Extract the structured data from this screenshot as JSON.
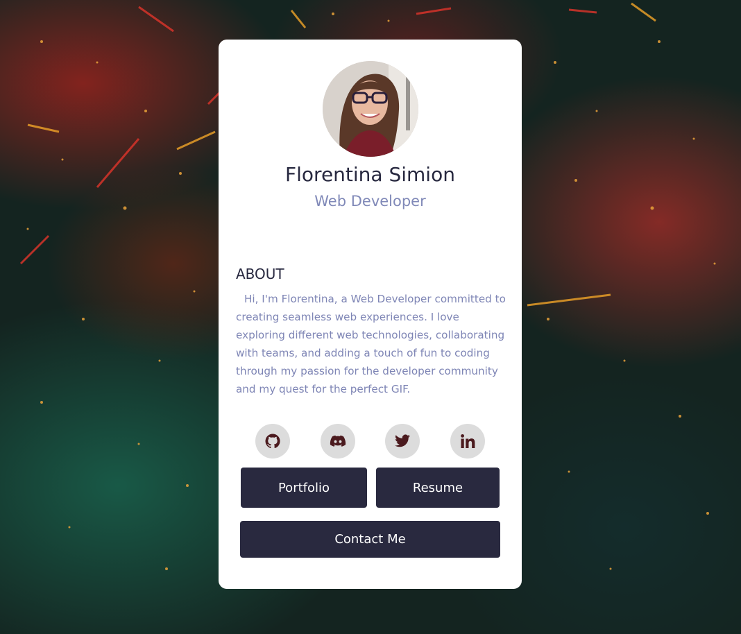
{
  "profile": {
    "name": "Florentina Simion",
    "role": "Web Developer"
  },
  "about": {
    "heading": "ABOUT",
    "text": "Hi, I'm Florentina, a Web Developer committed to creating seamless web experiences. I love exploring different web technologies, collaborating with teams, and adding a touch of fun to coding through my passion for the developer community and my quest for the perfect GIF."
  },
  "social": [
    {
      "icon": "github-icon"
    },
    {
      "icon": "discord-icon"
    },
    {
      "icon": "twitter-icon"
    },
    {
      "icon": "linkedin-icon"
    }
  ],
  "buttons": {
    "portfolio": "Portfolio",
    "resume": "Resume",
    "contact": "Contact Me"
  },
  "colors": {
    "button_bg": "#29293f",
    "name_color": "#27283f",
    "accent_text": "#8089b8",
    "icon_color": "#4b1a1e",
    "icon_bg": "#dcdcdc"
  }
}
